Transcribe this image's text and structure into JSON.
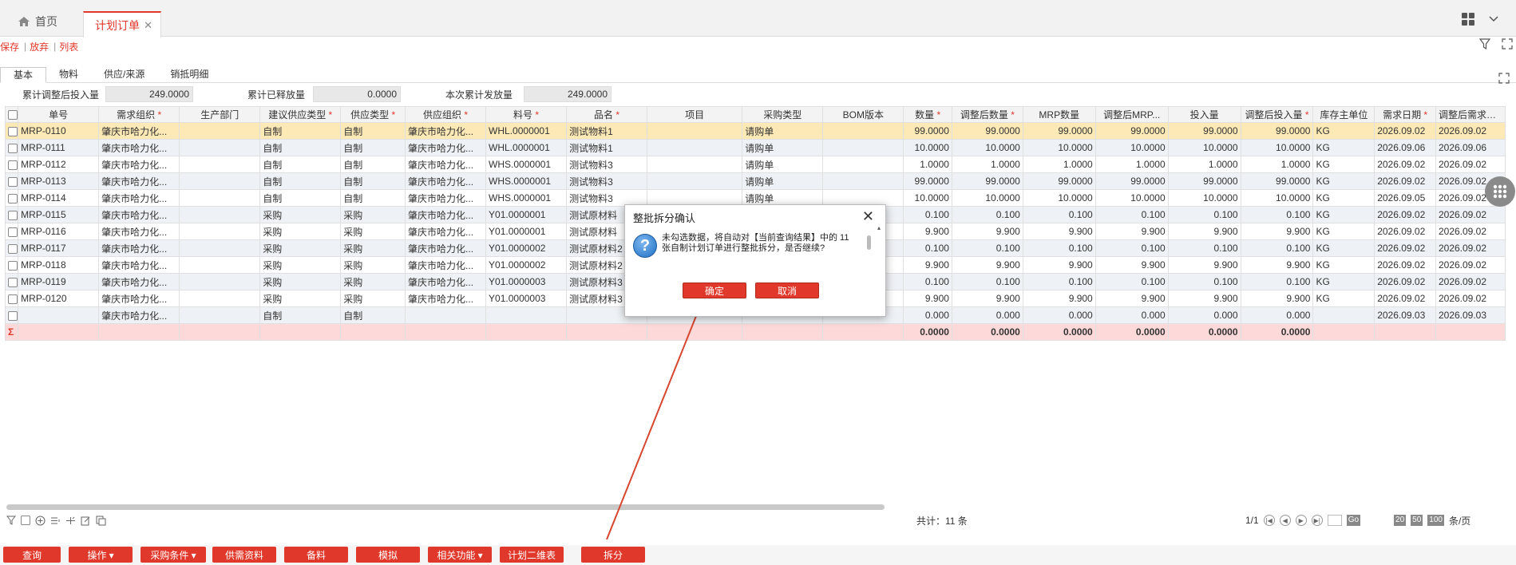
{
  "tabs": {
    "home": "首页",
    "active": "计划订单"
  },
  "toolbar": {
    "save": "保存",
    "discard": "放弃",
    "list": "列表"
  },
  "subtabs": [
    "基本",
    "物料",
    "供应/来源",
    "销抵明细"
  ],
  "summary": {
    "adjusted_input_label": "累计调整后投入量",
    "adjusted_input_value": "249.0000",
    "released_label": "累计已释放量",
    "released_value": "0.0000",
    "current_issue_label": "本次累计发放量",
    "current_issue_value": "249.0000"
  },
  "columns": [
    {
      "label": "单号",
      "req": false
    },
    {
      "label": "需求组织",
      "req": true
    },
    {
      "label": "生产部门",
      "req": false
    },
    {
      "label": "建议供应类型",
      "req": true
    },
    {
      "label": "供应类型",
      "req": true
    },
    {
      "label": "供应组织",
      "req": true
    },
    {
      "label": "料号",
      "req": true
    },
    {
      "label": "品名",
      "req": true
    },
    {
      "label": "项目",
      "req": false
    },
    {
      "label": "采购类型",
      "req": false
    },
    {
      "label": "BOM版本",
      "req": false
    },
    {
      "label": "数量",
      "req": true
    },
    {
      "label": "调整后数量",
      "req": true
    },
    {
      "label": "MRP数量",
      "req": false
    },
    {
      "label": "调整后MRP...",
      "req": false
    },
    {
      "label": "投入量",
      "req": false
    },
    {
      "label": "调整后投入量",
      "req": true
    },
    {
      "label": "库存主单位",
      "req": false
    },
    {
      "label": "需求日期",
      "req": true
    },
    {
      "label": "调整后需求日期",
      "req": false
    }
  ],
  "rows": [
    [
      "MRP-0110",
      "肇庆市哈力化...",
      "",
      "自制",
      "自制",
      "肇庆市哈力化...",
      "WHL.0000001",
      "测试物料1",
      "",
      "请购单",
      "",
      "99.0000",
      "99.0000",
      "99.0000",
      "99.0000",
      "99.0000",
      "99.0000",
      "KG",
      "2026.09.02",
      "2026.09.02"
    ],
    [
      "MRP-0111",
      "肇庆市哈力化...",
      "",
      "自制",
      "自制",
      "肇庆市哈力化...",
      "WHL.0000001",
      "测试物料1",
      "",
      "请购单",
      "",
      "10.0000",
      "10.0000",
      "10.0000",
      "10.0000",
      "10.0000",
      "10.0000",
      "KG",
      "2026.09.06",
      "2026.09.06"
    ],
    [
      "MRP-0112",
      "肇庆市哈力化...",
      "",
      "自制",
      "自制",
      "肇庆市哈力化...",
      "WHS.0000001",
      "测试物料3",
      "",
      "请购单",
      "",
      "1.0000",
      "1.0000",
      "1.0000",
      "1.0000",
      "1.0000",
      "1.0000",
      "KG",
      "2026.09.02",
      "2026.09.02"
    ],
    [
      "MRP-0113",
      "肇庆市哈力化...",
      "",
      "自制",
      "自制",
      "肇庆市哈力化...",
      "WHS.0000001",
      "测试物料3",
      "",
      "请购单",
      "",
      "99.0000",
      "99.0000",
      "99.0000",
      "99.0000",
      "99.0000",
      "99.0000",
      "KG",
      "2026.09.02",
      "2026.09.02"
    ],
    [
      "MRP-0114",
      "肇庆市哈力化...",
      "",
      "自制",
      "自制",
      "肇庆市哈力化...",
      "WHS.0000001",
      "测试物料3",
      "",
      "请购单",
      "",
      "10.0000",
      "10.0000",
      "10.0000",
      "10.0000",
      "10.0000",
      "10.0000",
      "KG",
      "2026.09.05",
      "2026.09.02"
    ],
    [
      "MRP-0115",
      "肇庆市哈力化...",
      "",
      "采购",
      "采购",
      "肇庆市哈力化...",
      "Y01.0000001",
      "测试原材料",
      "",
      "",
      "",
      "0.100",
      "0.100",
      "0.100",
      "0.100",
      "0.100",
      "0.100",
      "KG",
      "2026.09.02",
      "2026.09.02"
    ],
    [
      "MRP-0116",
      "肇庆市哈力化...",
      "",
      "采购",
      "采购",
      "肇庆市哈力化...",
      "Y01.0000001",
      "测试原材料",
      "",
      "",
      "",
      "9.900",
      "9.900",
      "9.900",
      "9.900",
      "9.900",
      "9.900",
      "KG",
      "2026.09.02",
      "2026.09.02"
    ],
    [
      "MRP-0117",
      "肇庆市哈力化...",
      "",
      "采购",
      "采购",
      "肇庆市哈力化...",
      "Y01.0000002",
      "测试原材料2",
      "",
      "",
      "",
      "0.100",
      "0.100",
      "0.100",
      "0.100",
      "0.100",
      "0.100",
      "KG",
      "2026.09.02",
      "2026.09.02"
    ],
    [
      "MRP-0118",
      "肇庆市哈力化...",
      "",
      "采购",
      "采购",
      "肇庆市哈力化...",
      "Y01.0000002",
      "测试原材料2",
      "",
      "",
      "",
      "9.900",
      "9.900",
      "9.900",
      "9.900",
      "9.900",
      "9.900",
      "KG",
      "2026.09.02",
      "2026.09.02"
    ],
    [
      "MRP-0119",
      "肇庆市哈力化...",
      "",
      "采购",
      "采购",
      "肇庆市哈力化...",
      "Y01.0000003",
      "测试原材料3",
      "",
      "",
      "",
      "0.100",
      "0.100",
      "0.100",
      "0.100",
      "0.100",
      "0.100",
      "KG",
      "2026.09.02",
      "2026.09.02"
    ],
    [
      "MRP-0120",
      "肇庆市哈力化...",
      "",
      "采购",
      "采购",
      "肇庆市哈力化...",
      "Y01.0000003",
      "测试原材料3",
      "",
      "",
      "",
      "9.900",
      "9.900",
      "9.900",
      "9.900",
      "9.900",
      "9.900",
      "KG",
      "2026.09.02",
      "2026.09.02"
    ],
    [
      "",
      "肇庆市哈力化...",
      "",
      "自制",
      "自制",
      "",
      "",
      "",
      "",
      "",
      "",
      "0.000",
      "0.000",
      "0.000",
      "0.000",
      "0.000",
      "0.000",
      "",
      "2026.09.03",
      "2026.09.03"
    ]
  ],
  "sum_row": [
    "0.0000",
    "0.0000",
    "0.0000",
    "0.0000",
    "0.0000",
    "0.0000"
  ],
  "footer": {
    "total": "共计：11 条",
    "page": "1/1",
    "go": "Go",
    "size20": "20",
    "size50": "50",
    "size100": "100",
    "per_page": "条/页"
  },
  "actions": [
    {
      "label": "查询"
    },
    {
      "label": "操作 ▾"
    },
    {
      "label": "采购条件 ▾"
    },
    {
      "label": "供需资料"
    },
    {
      "label": "备料"
    },
    {
      "label": "模拟"
    },
    {
      "label": "相关功能 ▾"
    },
    {
      "label": "计划二维表"
    },
    {
      "label": "拆分"
    }
  ],
  "modal": {
    "title": "整批拆分确认",
    "message": "未勾选数据，将自动对【当前查询结果】中的 11 张自制计划订单进行整批拆分，是否继续?",
    "confirm": "确定",
    "cancel": "取消"
  },
  "colors": {
    "accent": "#e0382a",
    "selected_row": "#fde9b6",
    "sum_row": "#fdd9d9"
  }
}
